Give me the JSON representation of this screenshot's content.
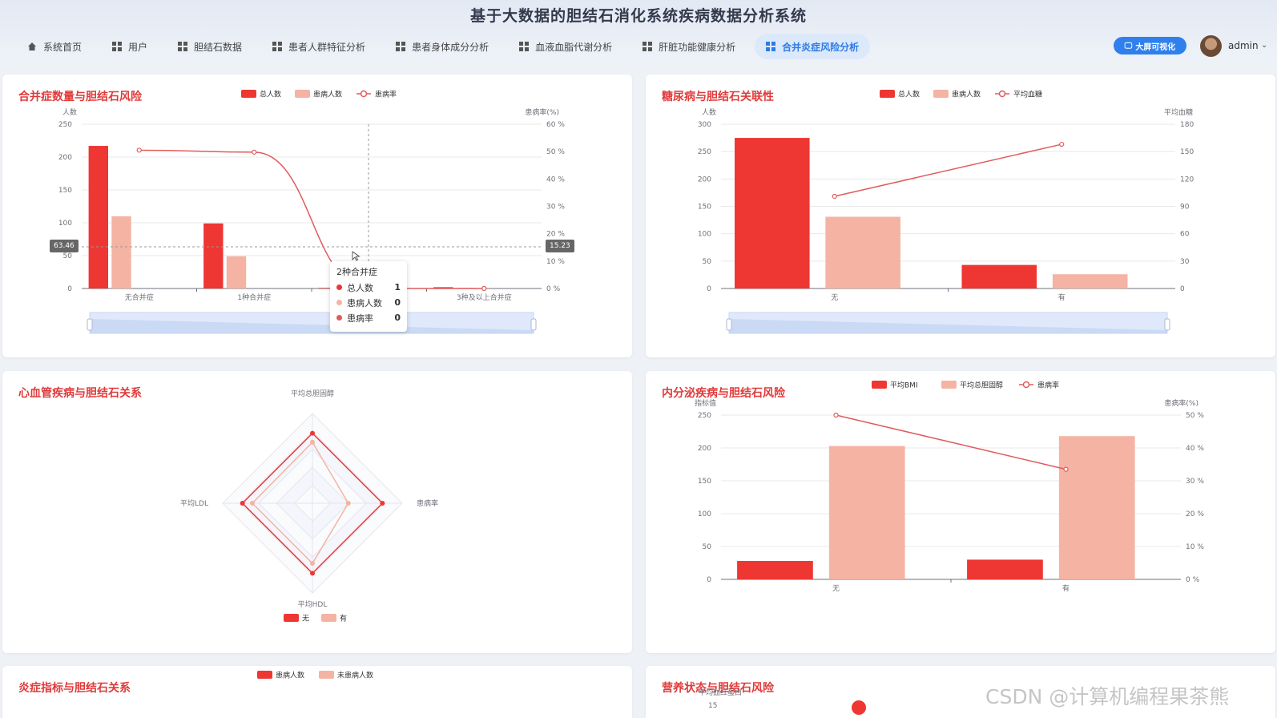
{
  "app": {
    "title": "基于大数据的胆结石消化系统疾病数据分析系统",
    "big_screen_label": "大屏可视化",
    "user": "admin"
  },
  "nav": [
    {
      "label": "系统首页",
      "icon": "home-icon"
    },
    {
      "label": "用户",
      "icon": "grid-icon"
    },
    {
      "label": "胆结石数据",
      "icon": "grid-icon"
    },
    {
      "label": "患者人群特征分析",
      "icon": "grid-icon"
    },
    {
      "label": "患者身体成分分析",
      "icon": "grid-icon"
    },
    {
      "label": "血液血脂代谢分析",
      "icon": "grid-icon"
    },
    {
      "label": "肝脏功能健康分析",
      "icon": "grid-icon"
    },
    {
      "label": "合并炎症风险分析",
      "icon": "grid-icon",
      "active": true
    }
  ],
  "colors": {
    "total": "#ee3633",
    "sick": "#f4b3a3",
    "line": "#e05c5c",
    "accent": "#2f80ed",
    "title": "#e03a3a"
  },
  "cards": {
    "c1": {
      "title": "合并症数量与胆结石风险"
    },
    "c2": {
      "title": "糖尿病与胆结石关联性"
    },
    "c3": {
      "title": "心血管疾病与胆结石关系"
    },
    "c4": {
      "title": "内分泌疾病与胆结石风险"
    },
    "c5": {
      "title": "炎症指标与胆结石关系"
    },
    "c6": {
      "title": "营养状态与胆结石风险"
    }
  },
  "tooltip": {
    "title": "2种合并症",
    "rows": [
      {
        "label": "总人数",
        "value": "1"
      },
      {
        "label": "患病人数",
        "value": "0"
      },
      {
        "label": "患病率",
        "value": "0"
      }
    ]
  },
  "axis_pointer": {
    "left": "63.46",
    "right": "15.23"
  },
  "watermark": "CSDN @计算机编程果茶熊",
  "chart_data": [
    {
      "id": "c1",
      "type": "bar",
      "categories": [
        "无合并症",
        "1种合并症",
        "2种合并症",
        "3种及以上合并症"
      ],
      "series": [
        {
          "name": "总人数",
          "kind": "bar",
          "values": [
            217,
            99,
            1,
            2
          ]
        },
        {
          "name": "患病人数",
          "kind": "bar",
          "values": [
            110,
            49,
            0,
            1
          ]
        },
        {
          "name": "患病率",
          "kind": "line",
          "axis": "right",
          "values": [
            50.5,
            49.8,
            0,
            0
          ]
        }
      ],
      "ylabel": "人数",
      "ylabel2": "患病率(%)",
      "ylim": [
        0,
        250
      ],
      "y2lim": [
        0,
        60
      ],
      "yticks": [
        0,
        50,
        100,
        150,
        200,
        250
      ],
      "y2ticks": [
        "0 %",
        "10 %",
        "20 %",
        "30 %",
        "40 %",
        "50 %",
        "60 %"
      ],
      "legend": "top"
    },
    {
      "id": "c2",
      "type": "bar",
      "categories": [
        "无",
        "有"
      ],
      "series": [
        {
          "name": "总人数",
          "kind": "bar",
          "values": [
            275,
            43
          ]
        },
        {
          "name": "患病人数",
          "kind": "bar",
          "values": [
            131,
            26
          ]
        },
        {
          "name": "平均血糖",
          "kind": "line",
          "axis": "right",
          "values": [
            101,
            158
          ]
        }
      ],
      "ylabel": "人数",
      "ylabel2": "平均血糖",
      "ylim": [
        0,
        300
      ],
      "y2lim": [
        0,
        180
      ],
      "yticks": [
        0,
        50,
        100,
        150,
        200,
        250,
        300
      ],
      "y2ticks": [
        "0",
        "30",
        "60",
        "90",
        "120",
        "150",
        "180"
      ],
      "legend": "top"
    },
    {
      "id": "c3",
      "type": "radar",
      "indicators": [
        "平均总胆固醇",
        "患病率",
        "平均HDL",
        "平均LDL"
      ],
      "series": [
        {
          "name": "无",
          "values": [
            0.78,
            0.78,
            0.78,
            0.78
          ]
        },
        {
          "name": "有",
          "values": [
            0.68,
            0.4,
            0.67,
            0.67
          ]
        }
      ],
      "legend": "bottom"
    },
    {
      "id": "c4",
      "type": "bar",
      "categories": [
        "无",
        "有"
      ],
      "series": [
        {
          "name": "平均BMI",
          "kind": "bar",
          "values": [
            28,
            30
          ]
        },
        {
          "name": "平均总胆固醇",
          "kind": "bar",
          "values": [
            203,
            218
          ]
        },
        {
          "name": "患病率",
          "kind": "line",
          "axis": "right",
          "values": [
            50,
            33.5
          ]
        }
      ],
      "ylabel": "指标值",
      "ylabel2": "患病率(%)",
      "ylim": [
        0,
        250
      ],
      "y2lim": [
        0,
        50
      ],
      "yticks": [
        0,
        50,
        100,
        150,
        200,
        250
      ],
      "y2ticks": [
        "0 %",
        "10 %",
        "20 %",
        "30 %",
        "40 %",
        "50 %"
      ],
      "legend": "top"
    },
    {
      "id": "c5",
      "type": "bar",
      "series": [
        {
          "name": "患病人数"
        },
        {
          "name": "未患病人数"
        }
      ],
      "legend": "top"
    },
    {
      "id": "c6",
      "type": "scatter",
      "ylabel": "平均血红蛋白",
      "yticks": [
        "15"
      ]
    }
  ]
}
